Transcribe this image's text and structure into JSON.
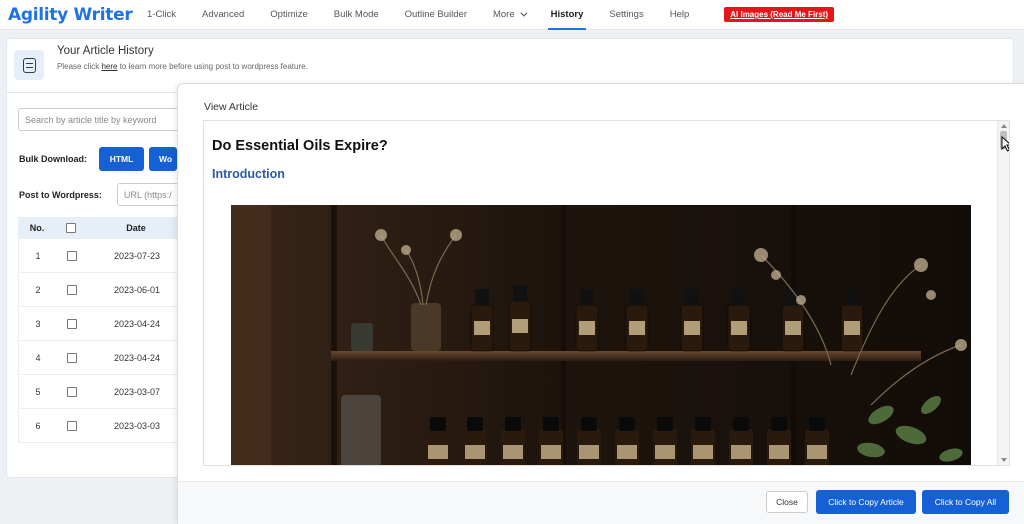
{
  "brand": "Agility Writer",
  "nav": {
    "items": [
      "1-Click",
      "Advanced",
      "Optimize",
      "Bulk Mode",
      "Outline Builder",
      "More",
      "History",
      "Settings",
      "Help"
    ],
    "active": "History",
    "ai_button": "AI Images (Read Me First)"
  },
  "history": {
    "title": "Your Article History",
    "subtitle_pre": "Please click ",
    "subtitle_link": "here",
    "subtitle_post": " to learn more before using post to wordpress feature.",
    "search_placeholder": "Search by article title by keyword",
    "bulk_label": "Bulk Download:",
    "bulk_html": "HTML",
    "bulk_word": "Wo",
    "wp_label": "Post to Wordpress:",
    "wp_placeholder": "URL (https:/",
    "table": {
      "headers": [
        "No.",
        "",
        "Date"
      ],
      "rows": [
        {
          "no": "1",
          "date": "2023-07-23"
        },
        {
          "no": "2",
          "date": "2023-06-01"
        },
        {
          "no": "3",
          "date": "2023-04-24"
        },
        {
          "no": "4",
          "date": "2023-04-24"
        },
        {
          "no": "5",
          "date": "2023-03-07"
        },
        {
          "no": "6",
          "date": "2023-03-03"
        }
      ]
    }
  },
  "modal": {
    "title": "View Article",
    "article_title": "Do Essential Oils Expire?",
    "section_heading": "Introduction",
    "close": "Close",
    "copy_article": "Click to Copy Article",
    "copy_all": "Click to Copy All"
  },
  "colors": {
    "brand": "#1f72e6",
    "primary": "#1560d4",
    "danger": "#e8141a",
    "heading": "#2a5aa6"
  },
  "icons": [
    "document-icon",
    "chevron-down-icon",
    "cursor-icon"
  ]
}
